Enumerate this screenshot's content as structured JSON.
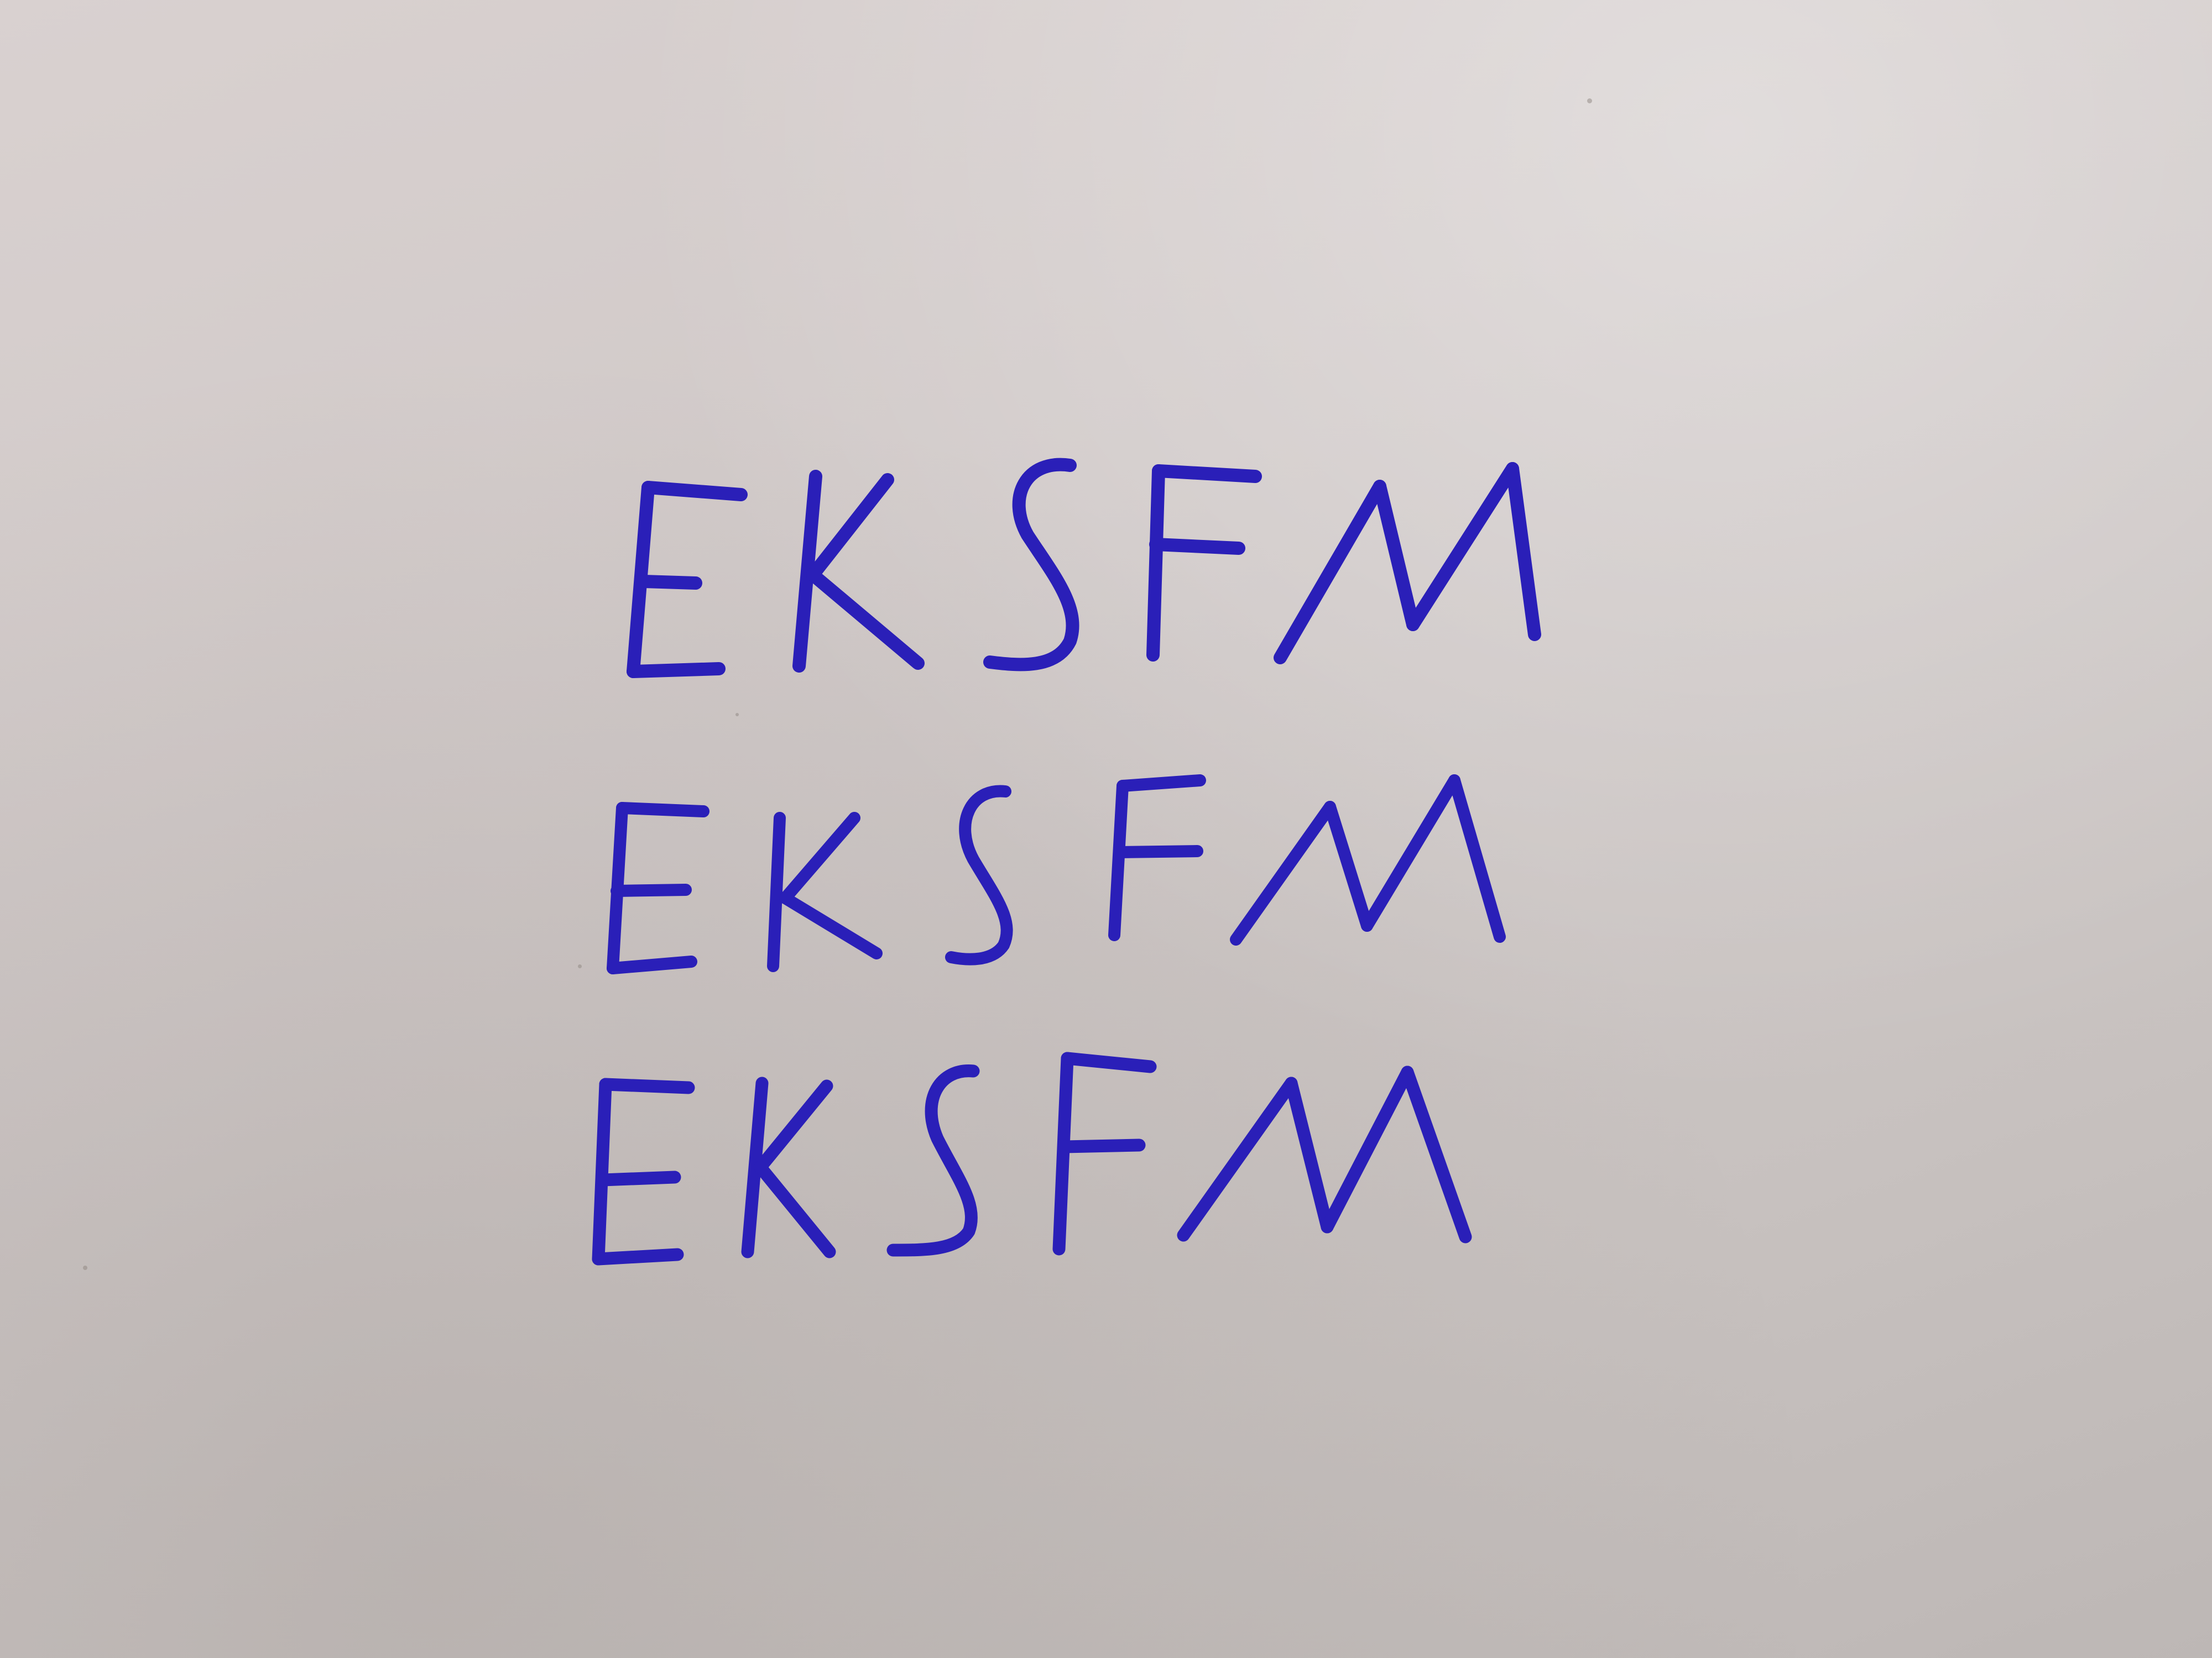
{
  "handwriting": {
    "ink_color": "#2a1fb8",
    "paper_color": "#d2cbca",
    "lines": [
      "EKSFM",
      "EKSFM",
      "EKSFM"
    ]
  }
}
